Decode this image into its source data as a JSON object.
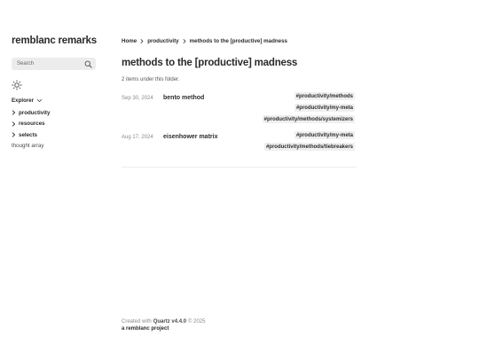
{
  "site": {
    "title": "remblanc remarks"
  },
  "search": {
    "placeholder": "Search"
  },
  "explorer": {
    "label": "Explorer",
    "folders": [
      {
        "label": "productivity"
      },
      {
        "label": "resources"
      },
      {
        "label": "selects"
      }
    ],
    "files": [
      {
        "label": "thought array"
      }
    ]
  },
  "breadcrumb": {
    "home": "Home",
    "folder": "productivity",
    "current": "methods to the [productive] madness"
  },
  "page": {
    "title": "methods to the [productive] madness",
    "item_count": "2 items under this folder."
  },
  "notes": [
    {
      "date": "Sep 30, 2024",
      "title": "bento method",
      "tags": [
        "#productivity/methods",
        "#productivity/my-meta",
        "#productivity/methods/systemizers"
      ]
    },
    {
      "date": "Aug 17, 2024",
      "title": "eisenhower matrix",
      "tags": [
        "#productivity/my-meta",
        "#productivity/methods/tiebreakers"
      ]
    }
  ],
  "footer": {
    "created_with": "Created with",
    "quartz": "Quartz v4.4.0",
    "copyright": "© 2025",
    "project": "a remblanc project"
  },
  "icons": {
    "search": "search-icon",
    "theme": "sun-icon",
    "explorer_toggle": "chevron-down-icon",
    "folder_toggle": "chevron-right-icon",
    "breadcrumb_separator": "chevron-right-icon"
  }
}
